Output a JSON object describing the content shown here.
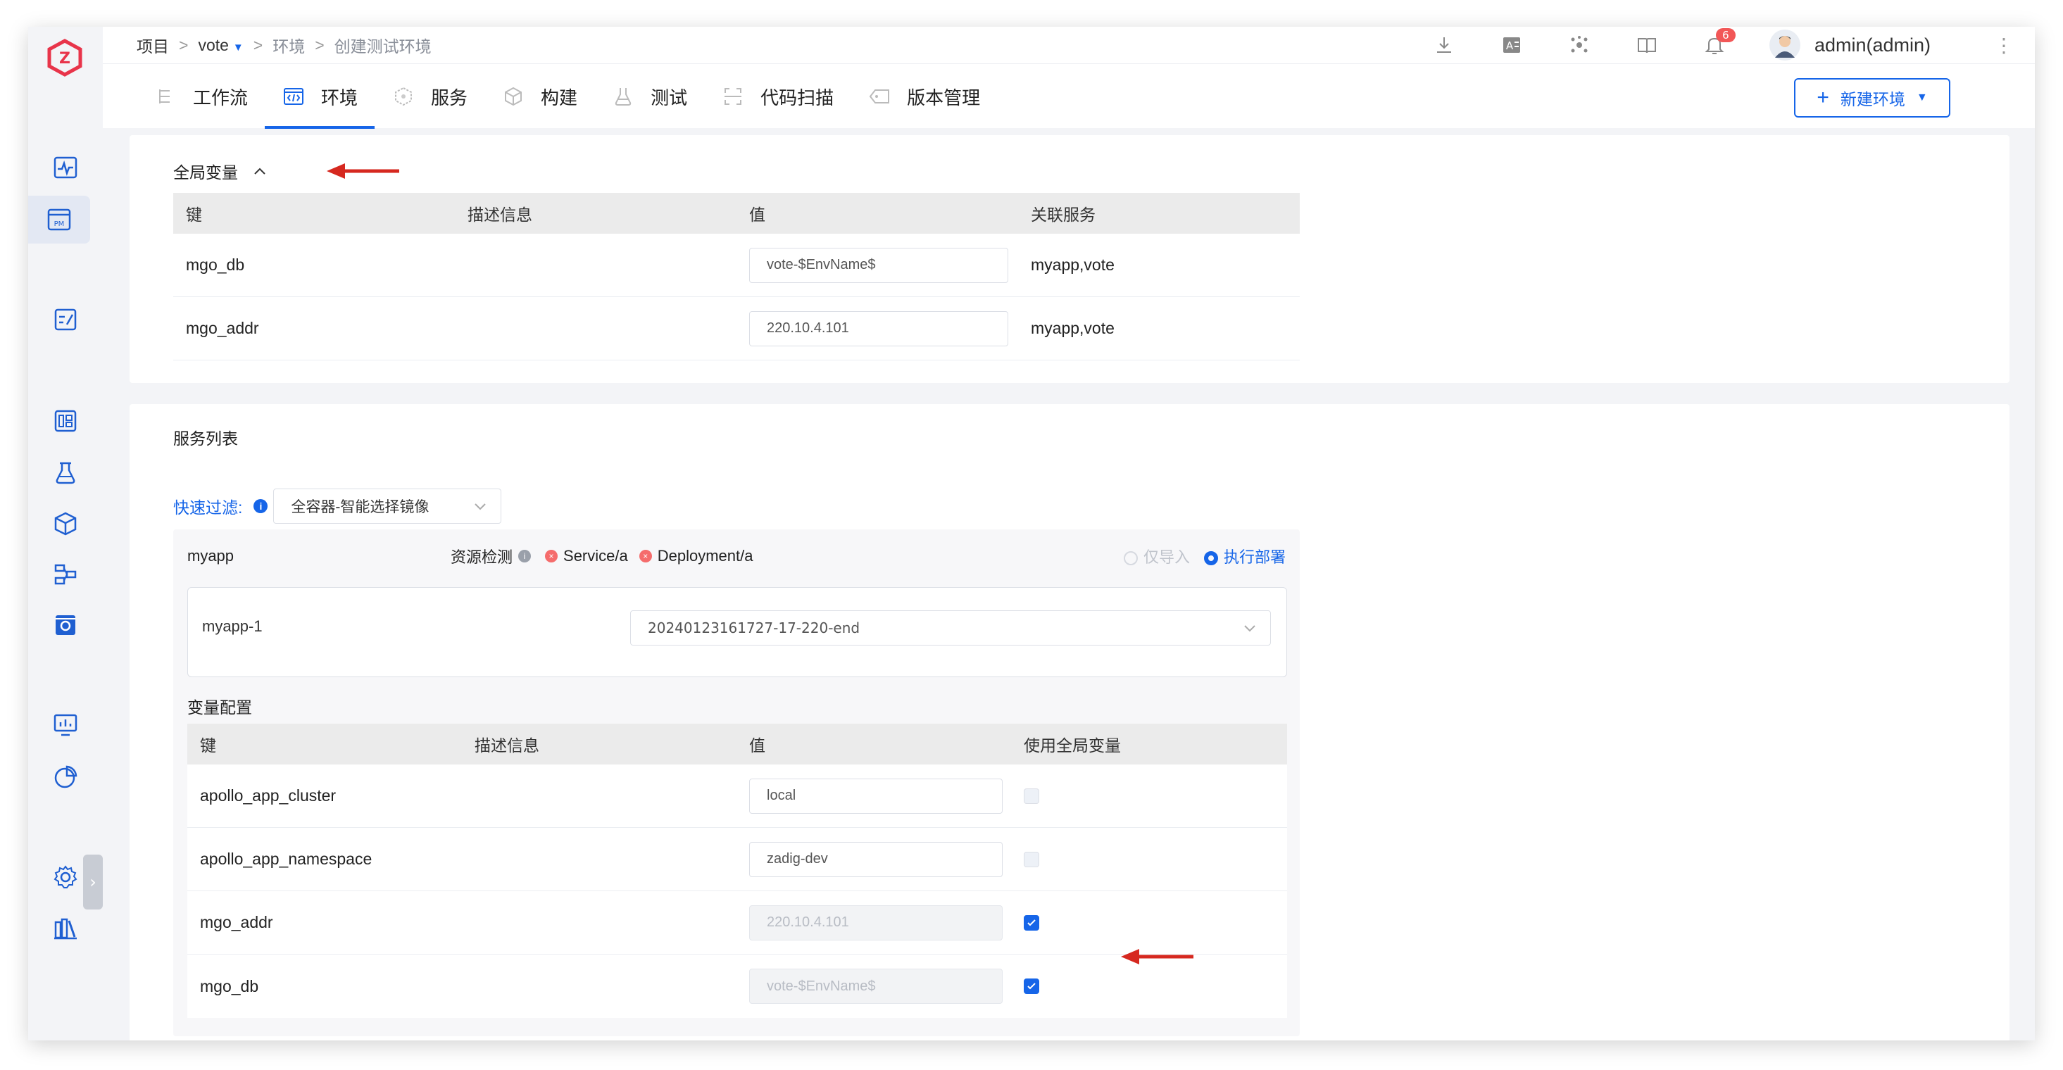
{
  "breadcrumb": {
    "items": [
      "项目",
      "vote",
      "环境",
      "创建测试环境"
    ],
    "separator": ">"
  },
  "user": {
    "name": "admin(admin)",
    "notifications": "6"
  },
  "top_icons": [
    "download-icon",
    "translate-icon",
    "scatter-icon",
    "book-icon",
    "bell-icon"
  ],
  "tabs": [
    {
      "label": "工作流",
      "icon": "workflow-icon",
      "active": false
    },
    {
      "label": "环境",
      "icon": "code-icon",
      "active": true
    },
    {
      "label": "服务",
      "icon": "cube-icon",
      "active": false
    },
    {
      "label": "构建",
      "icon": "box-icon",
      "active": false
    },
    {
      "label": "测试",
      "icon": "flask-icon",
      "active": false
    },
    {
      "label": "代码扫描",
      "icon": "scan-icon",
      "active": false
    },
    {
      "label": "版本管理",
      "icon": "tag-icon",
      "active": false
    }
  ],
  "new_env_button": "新建环境",
  "global_vars": {
    "title": "全局变量",
    "columns": [
      "键",
      "描述信息",
      "值",
      "关联服务"
    ],
    "rows": [
      {
        "key": "mgo_db",
        "desc": "",
        "value": "vote-$EnvName$",
        "services": "myapp,vote"
      },
      {
        "key": "mgo_addr",
        "desc": "",
        "value": "220.10.4.101",
        "services": "myapp,vote"
      }
    ]
  },
  "service_list": {
    "title": "服务列表",
    "filter_label": "快速过滤:",
    "filter_value": "全容器-智能选择镜像",
    "service": {
      "name": "myapp",
      "resource_check_label": "资源检测",
      "resources": [
        "Service/a",
        "Deployment/a"
      ],
      "mode_options": [
        "仅导入",
        "执行部署"
      ],
      "selected_mode": "执行部署",
      "container": {
        "name": "myapp-1",
        "image": "20240123161727-17-220-end"
      },
      "var_config": {
        "title": "变量配置",
        "columns": [
          "键",
          "描述信息",
          "值",
          "使用全局变量"
        ],
        "rows": [
          {
            "key": "apollo_app_cluster",
            "desc": "",
            "value": "local",
            "use_global": false
          },
          {
            "key": "apollo_app_namespace",
            "desc": "",
            "value": "zadig-dev",
            "use_global": false
          },
          {
            "key": "mgo_addr",
            "desc": "",
            "value": "220.10.4.101",
            "use_global": true
          },
          {
            "key": "mgo_db",
            "desc": "",
            "value": "vote-$EnvName$",
            "use_global": true
          }
        ]
      }
    }
  },
  "colors": {
    "accent": "#1665e8",
    "annotation_arrow": "#d6281f",
    "badge": "#f25757",
    "logo": "#e8344a"
  }
}
